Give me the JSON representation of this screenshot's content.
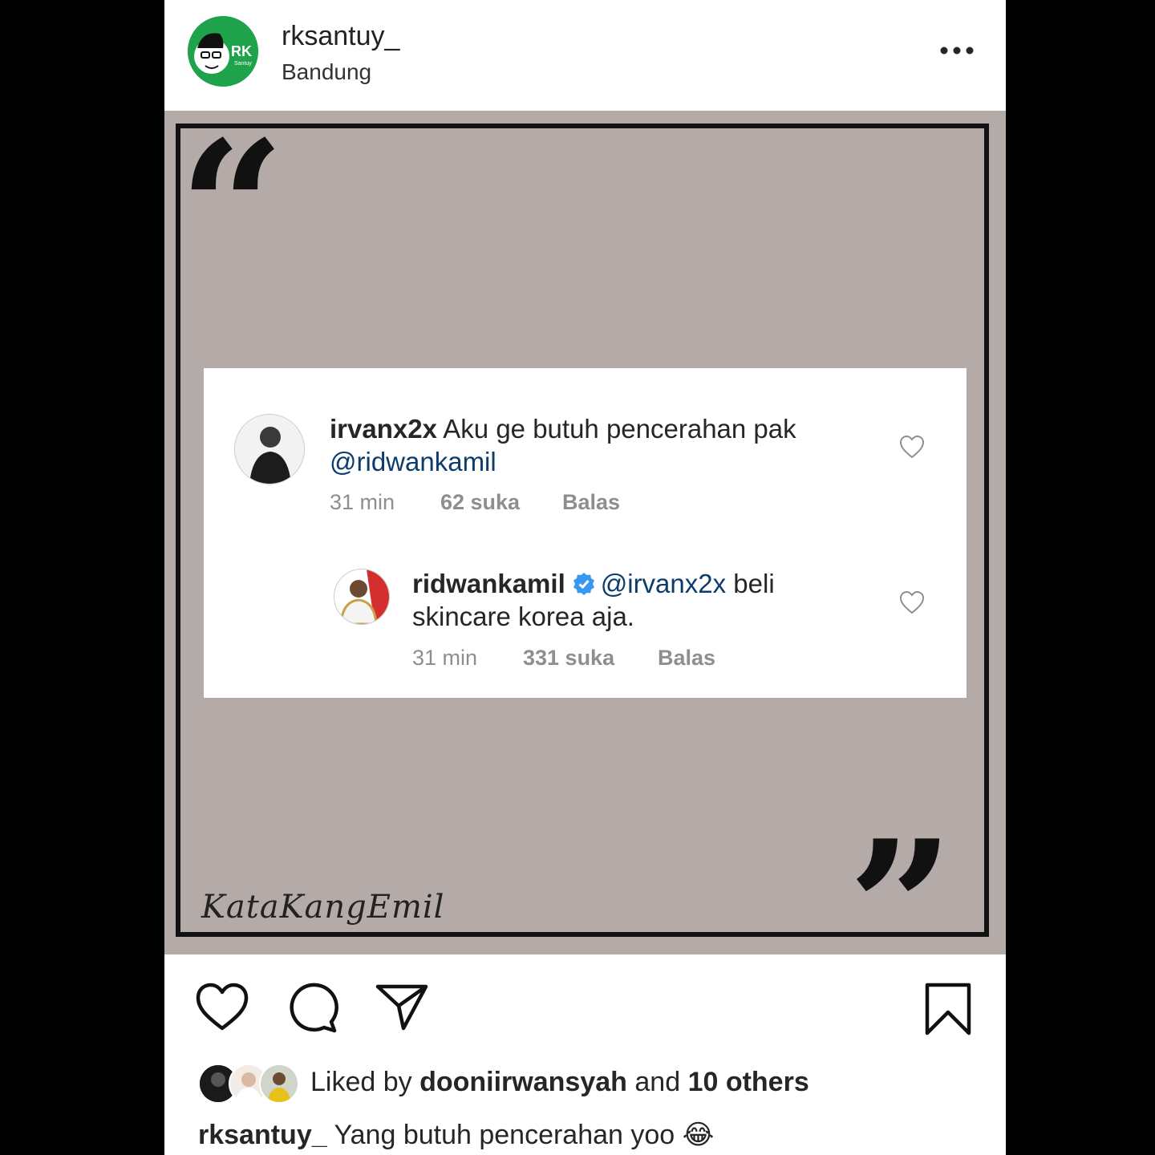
{
  "post": {
    "username": "rksantuy_",
    "location": "Bandung",
    "avatar_text": "RK",
    "avatar_subtext": "Santuy"
  },
  "image": {
    "signature": "KataKangEmil",
    "quote_open": "“",
    "quote_close": "”",
    "comments": [
      {
        "username": "irvanx2x",
        "text": "Aku ge butuh pencerahan pak",
        "mention": "@ridwankamil",
        "time": "31 min",
        "likes": "62 suka",
        "reply": "Balas"
      },
      {
        "username": "ridwankamil",
        "mention": "@irvanx2x",
        "text_line1": "beli",
        "text_line2": "skincare korea aja.",
        "time": "31 min",
        "likes": "331 suka",
        "reply": "Balas"
      }
    ]
  },
  "likes": {
    "prefix": "Liked by",
    "user": "dooniirwansyah",
    "middle": "and",
    "others": "10 others"
  },
  "caption": {
    "username": "rksantuy_",
    "text": "Yang butuh pencerahan yoo",
    "emoji": "😂"
  },
  "colors": {
    "image_bg": "#b4aba8",
    "avatar_green": "#1fa34a",
    "verified_blue": "#3897f0",
    "mention_blue": "#0b3c6d"
  }
}
